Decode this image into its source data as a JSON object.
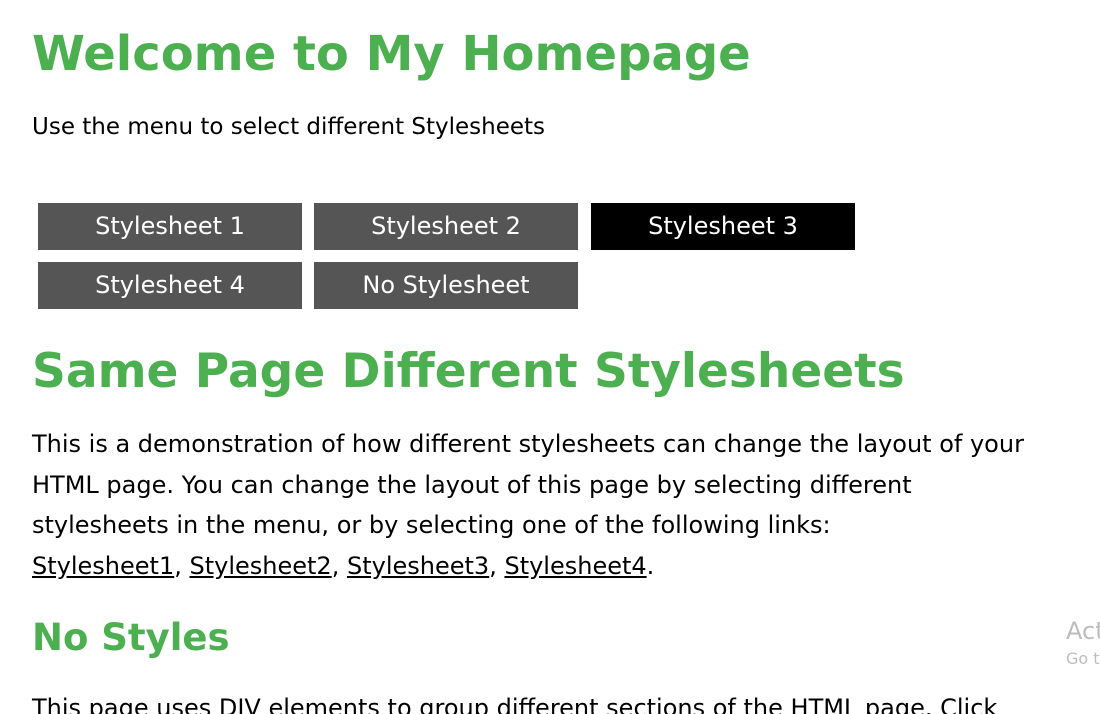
{
  "colors": {
    "heading": "#4caf50",
    "menu_button": "#555555",
    "menu_button_active": "#000000",
    "menu_text": "#ffffff",
    "body_text": "#000000",
    "watermark": "#bdbdbd"
  },
  "header": {
    "title": "Welcome to My Homepage",
    "intro": "Use the menu to select different Stylesheets"
  },
  "menu": {
    "items": [
      {
        "label": "Stylesheet 1",
        "active": false
      },
      {
        "label": "Stylesheet 2",
        "active": false
      },
      {
        "label": "Stylesheet 3",
        "active": true
      },
      {
        "label": "Stylesheet 4",
        "active": false
      },
      {
        "label": "No Stylesheet",
        "active": false
      }
    ]
  },
  "main": {
    "heading": "Same Page Different Stylesheets",
    "paragraph": {
      "line1": "This is a demonstration of how different stylesheets can change the layout of your",
      "line2": "HTML page. You can change the layout of this page by selecting different",
      "line3": "stylesheets in the menu, or by selecting one of the following links:",
      "links": [
        "Stylesheet1",
        "Stylesheet2",
        "Stylesheet3",
        "Stylesheet4"
      ],
      "separator": ", ",
      "end": "."
    },
    "section_heading": "No Styles",
    "section_text": "This page uses DIV elements to group different sections of the HTML page. Click"
  },
  "watermark": {
    "line1": "Act",
    "line2": "Go t"
  }
}
